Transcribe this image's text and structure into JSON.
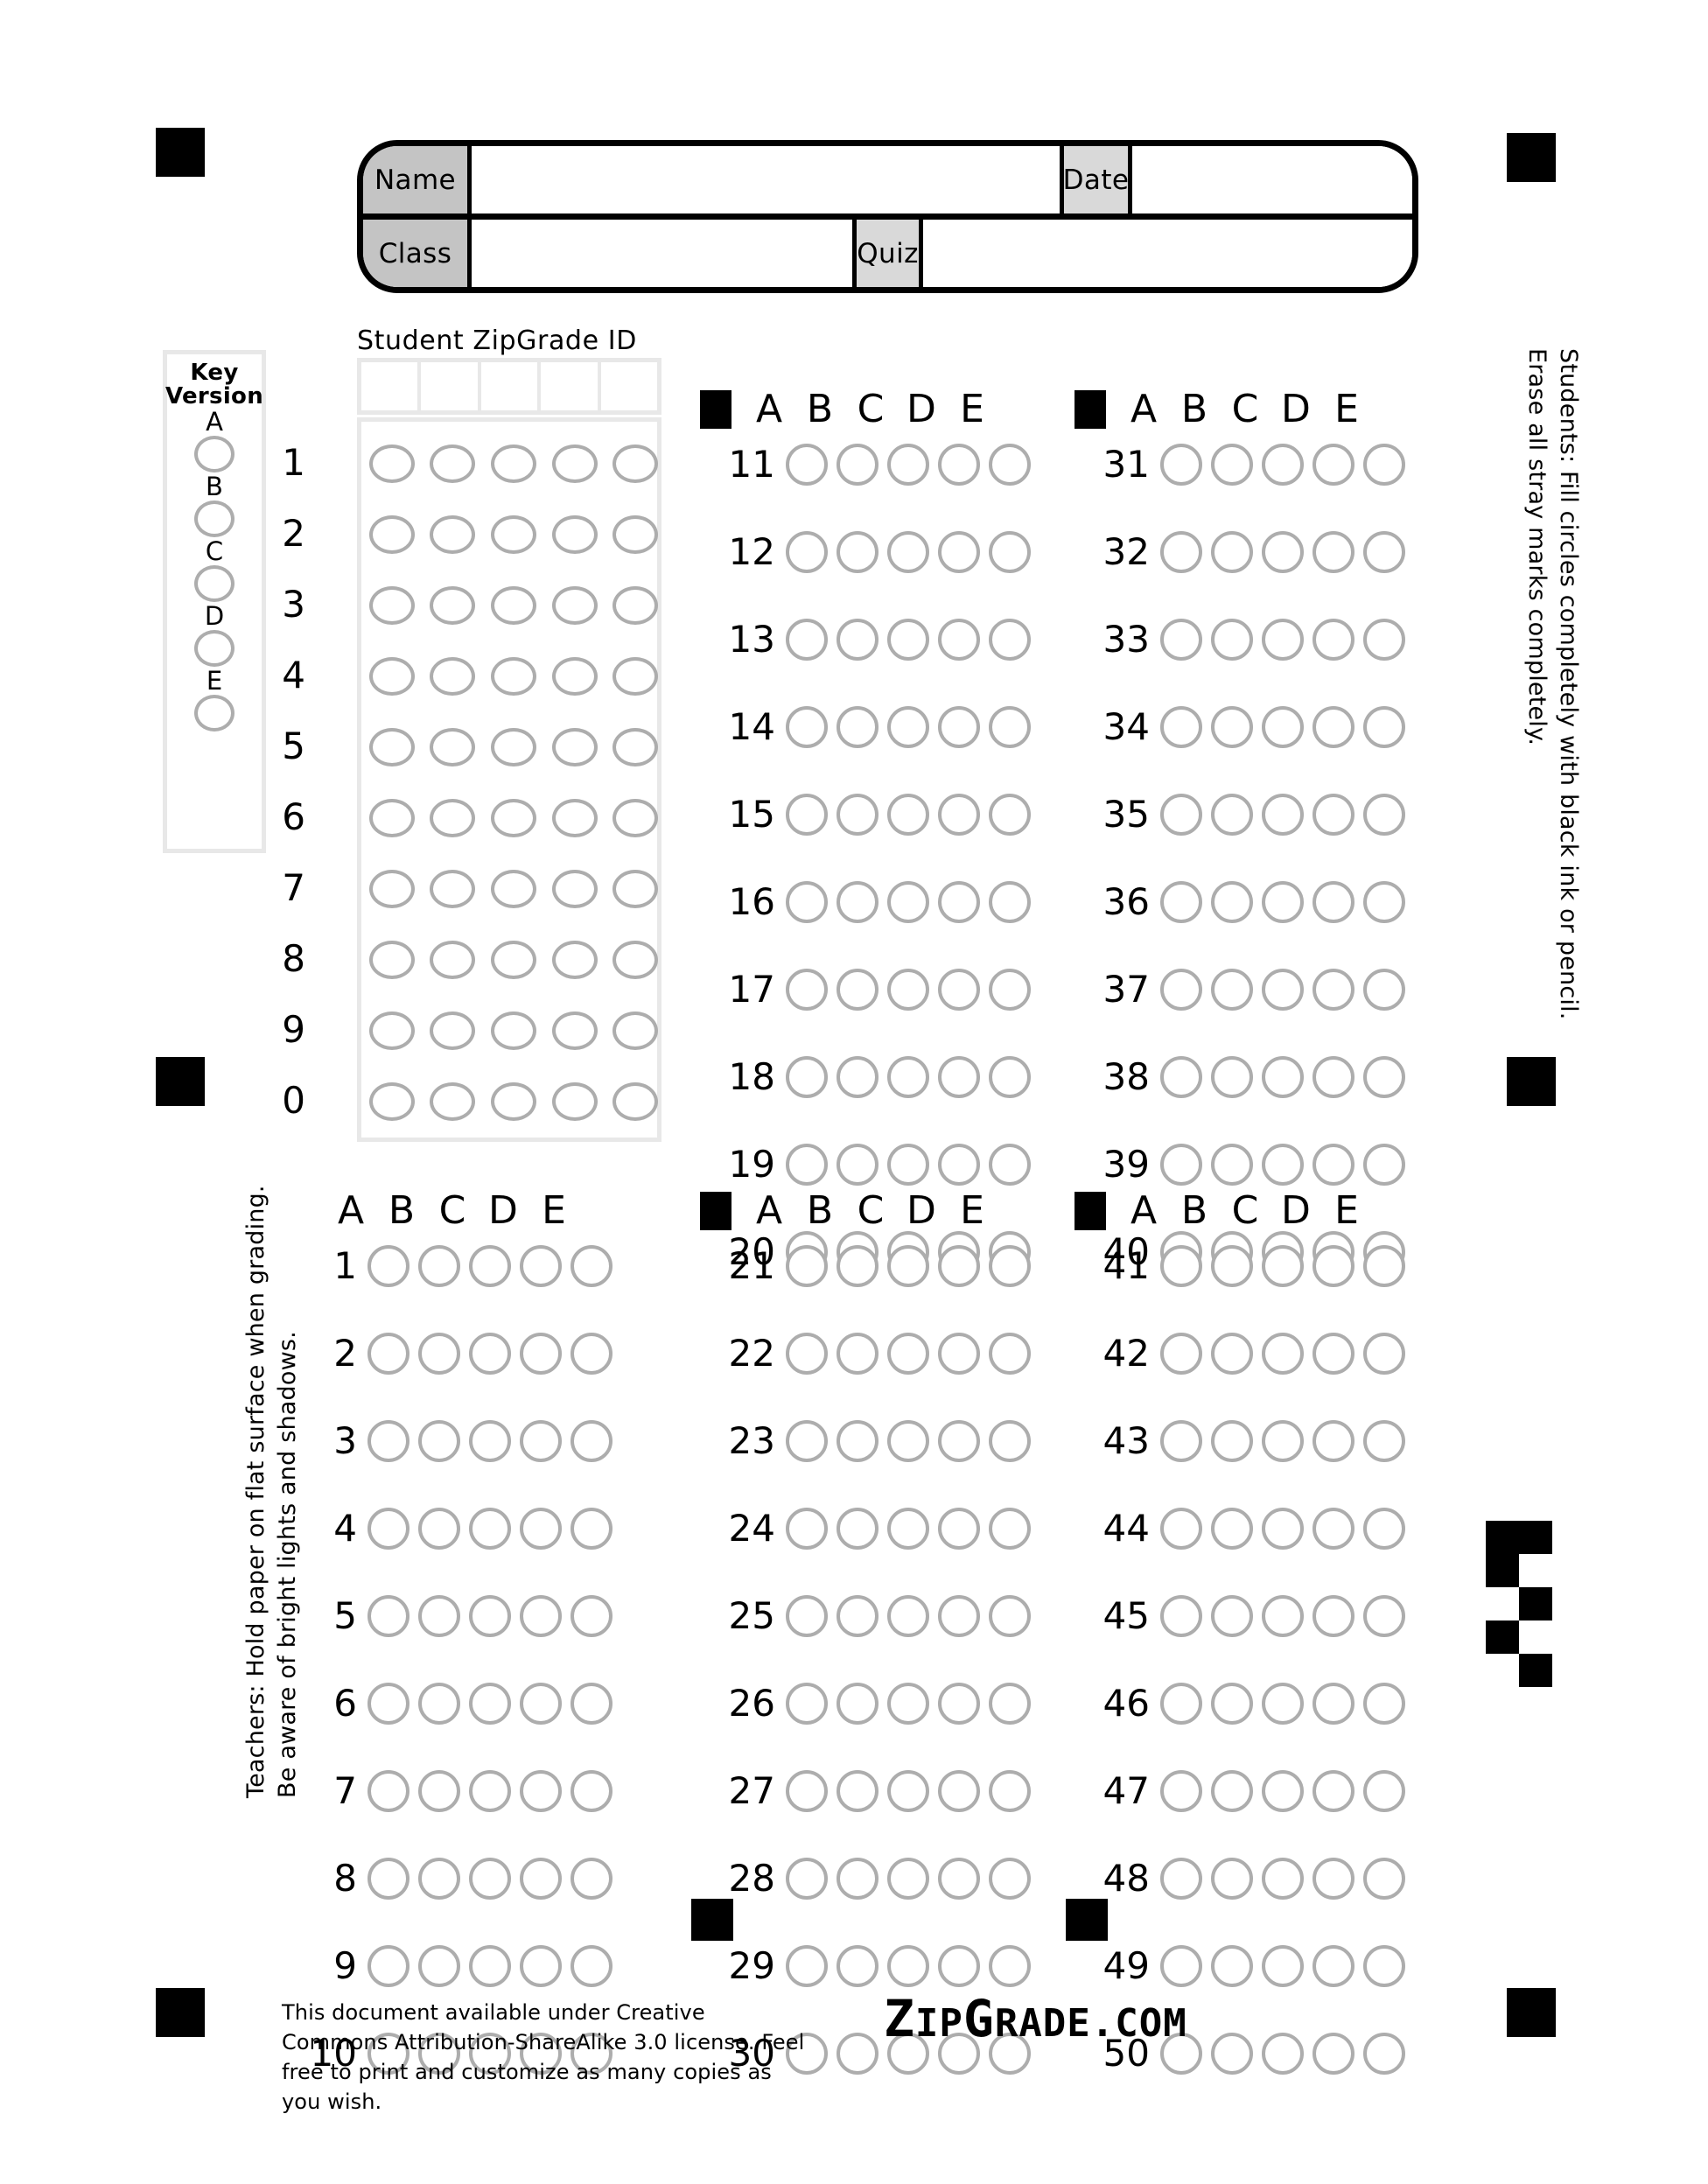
{
  "document": {
    "type": "ZipGrade 50-question answer sheet",
    "brand": {
      "z": "Z",
      "ip": "IP",
      "g": "G",
      "rade": "RADE",
      "dotcom": ".COM",
      "full": "ZipGrade.com"
    },
    "license_text": "This document available under Creative Commons Attribution-ShareAlike 3.0 license.  Feel free to print and customize as many copies as you wish."
  },
  "header": {
    "name_label": "Name",
    "date_label": "Date",
    "class_label": "Class",
    "quiz_label": "Quiz",
    "name_value": "",
    "date_value": "",
    "class_value": "",
    "quiz_value": ""
  },
  "key_version": {
    "title_line1": "Key",
    "title_line2": "Version",
    "options": [
      "A",
      "B",
      "C",
      "D",
      "E"
    ]
  },
  "student_id": {
    "label": "Student ZipGrade ID",
    "write_in_boxes": 5,
    "digits": [
      "1",
      "2",
      "3",
      "4",
      "5",
      "6",
      "7",
      "8",
      "9",
      "0"
    ],
    "columns": 5
  },
  "answer_options": [
    "A",
    "B",
    "C",
    "D",
    "E"
  ],
  "answer_columns": [
    {
      "name": "questions-1-10",
      "marker_square": false,
      "questions": [
        "1",
        "2",
        "3",
        "4",
        "5",
        "6",
        "7",
        "8",
        "9",
        "10"
      ]
    },
    {
      "name": "questions-11-20",
      "marker_square": true,
      "questions": [
        "11",
        "12",
        "13",
        "14",
        "15",
        "16",
        "17",
        "18",
        "19",
        "20"
      ]
    },
    {
      "name": "questions-21-30",
      "marker_square": true,
      "questions": [
        "21",
        "22",
        "23",
        "24",
        "25",
        "26",
        "27",
        "28",
        "29",
        "30"
      ]
    },
    {
      "name": "questions-31-40",
      "marker_square": true,
      "questions": [
        "31",
        "32",
        "33",
        "34",
        "35",
        "36",
        "37",
        "38",
        "39",
        "40"
      ]
    },
    {
      "name": "questions-41-50",
      "marker_square": true,
      "questions": [
        "41",
        "42",
        "43",
        "44",
        "45",
        "46",
        "47",
        "48",
        "49",
        "50"
      ]
    }
  ],
  "instructions": {
    "students_line1": "Students:  Fill circles completely with black ink or pencil.",
    "students_line2": "Erase all stray marks completely.",
    "teachers_line1": "Teachers: Hold paper on flat surface when grading.",
    "teachers_line2": "Be aware of bright lights and shadows."
  },
  "colors": {
    "bubble_stroke": "#adadad",
    "box_stroke": "#e8e8e8",
    "label_fill_dark": "#c4c4c4",
    "label_fill_light": "#d9d9d9",
    "registration": "#000000"
  },
  "marker_pattern": {
    "rows": [
      [
        1,
        1
      ],
      [
        1,
        0
      ],
      [
        0,
        1
      ],
      [
        1,
        0
      ],
      [
        0,
        1
      ]
    ]
  }
}
